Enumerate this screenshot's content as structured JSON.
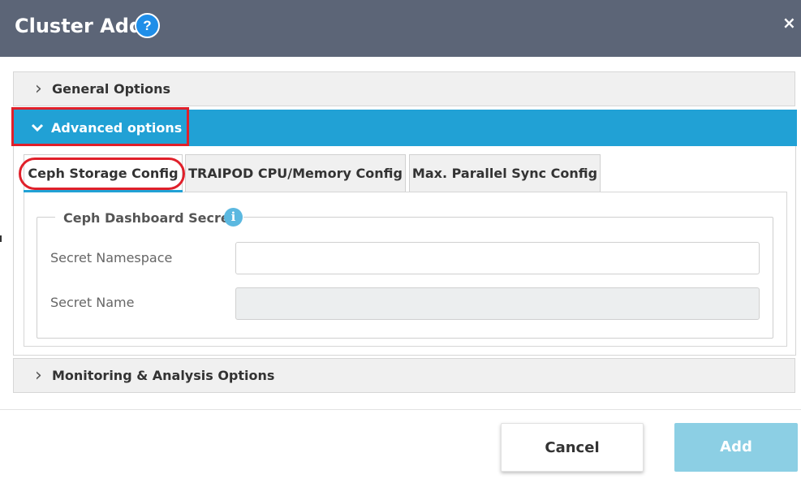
{
  "dialog": {
    "title": "Cluster Add",
    "help_glyph": "?",
    "close_glyph": "×"
  },
  "sections": {
    "general": {
      "label": "General Options",
      "expanded": false
    },
    "advanced": {
      "label": "Advanced options",
      "expanded": true
    },
    "monitoring": {
      "label": "Monitoring & Analysis Options",
      "expanded": false
    }
  },
  "tabs": [
    {
      "label": "Ceph Storage Config",
      "active": true
    },
    {
      "label": "TRAIPOD CPU/Memory Config",
      "active": false
    },
    {
      "label": "Max. Parallel Sync Config",
      "active": false
    }
  ],
  "ceph_secret": {
    "legend": "Ceph Dashboard Secret",
    "info_glyph": "i",
    "fields": [
      {
        "label": "Secret Namespace",
        "value": "",
        "disabled": false
      },
      {
        "label": "Secret Name",
        "value": "",
        "disabled": true
      }
    ]
  },
  "footer": {
    "cancel_label": "Cancel",
    "add_label": "Add"
  },
  "colors": {
    "header_bg": "#5c6577",
    "accent": "#21a1d5",
    "highlight_annotation": "#e0202a",
    "add_button_disabled": "#8ccfe4"
  }
}
